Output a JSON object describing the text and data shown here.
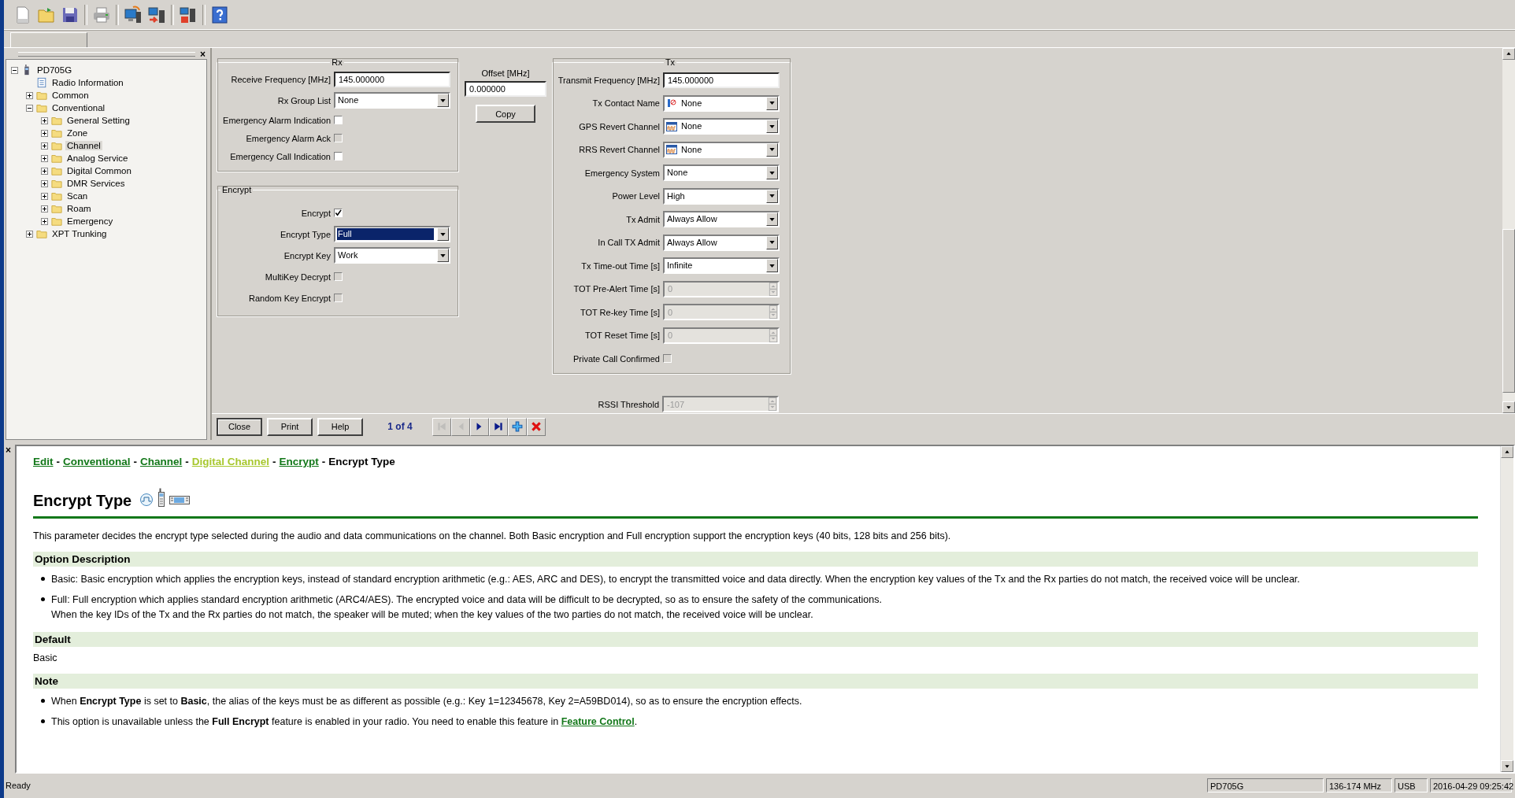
{
  "sidebar": {
    "close": "×",
    "tree": [
      {
        "label": "PD705G",
        "kind": "device",
        "expanded": true,
        "selected": false,
        "children": [
          {
            "label": "Radio Information",
            "kind": "document",
            "selected": false
          },
          {
            "label": "Common",
            "kind": "folder",
            "expanded": false,
            "selected": false
          },
          {
            "label": "Conventional",
            "kind": "folder",
            "expanded": true,
            "selected": false,
            "children": [
              {
                "label": "General Setting",
                "kind": "folder",
                "expanded": false,
                "selected": false
              },
              {
                "label": "Zone",
                "kind": "folder",
                "expanded": false,
                "selected": false
              },
              {
                "label": "Channel",
                "kind": "folder",
                "expanded": false,
                "selected": true
              },
              {
                "label": "Analog Service",
                "kind": "folder",
                "expanded": false,
                "selected": false
              },
              {
                "label": "Digital Common",
                "kind": "folder",
                "expanded": false,
                "selected": false
              },
              {
                "label": "DMR Services",
                "kind": "folder",
                "expanded": false,
                "selected": false
              },
              {
                "label": "Scan",
                "kind": "folder",
                "expanded": false,
                "selected": false
              },
              {
                "label": "Roam",
                "kind": "folder",
                "expanded": false,
                "selected": false
              },
              {
                "label": "Emergency",
                "kind": "folder",
                "expanded": false,
                "selected": false
              }
            ]
          },
          {
            "label": "XPT Trunking",
            "kind": "folder",
            "expanded": false,
            "selected": false
          }
        ]
      }
    ]
  },
  "rx": {
    "title": "Rx",
    "fields": [
      {
        "label": "Receive Frequency [MHz]",
        "kind": "text",
        "value": "145.000000"
      },
      {
        "label": "Rx Group List",
        "kind": "dropdown",
        "value": "None",
        "focused": false
      },
      {
        "label": "Emergency Alarm Indication",
        "kind": "checkbox",
        "checked": false,
        "disabled": false
      },
      {
        "label": "Emergency Alarm Ack",
        "kind": "checkbox",
        "checked": false,
        "disabled": true
      },
      {
        "label": "Emergency Call Indication",
        "kind": "checkbox",
        "checked": false,
        "disabled": false
      }
    ]
  },
  "encrypt": {
    "title": "Encrypt",
    "fields": [
      {
        "label": "Encrypt",
        "kind": "checkbox",
        "checked": true,
        "disabled": false
      },
      {
        "label": "Encrypt Type",
        "kind": "dropdown",
        "value": "Full",
        "focused": true
      },
      {
        "label": "Encrypt Key",
        "kind": "dropdown",
        "value": "Work",
        "focused": false
      },
      {
        "label": "MultiKey Decrypt",
        "kind": "checkbox",
        "checked": false,
        "disabled": true
      },
      {
        "label": "Random Key Encrypt",
        "kind": "checkbox",
        "checked": false,
        "disabled": true
      }
    ]
  },
  "offset": {
    "label": "Offset [MHz]",
    "value": "0.000000",
    "button": "Copy"
  },
  "tx": {
    "title": "Tx",
    "fields": [
      {
        "label": "Transmit Frequency [MHz]",
        "kind": "text",
        "value": "145.000000"
      },
      {
        "label": "Tx Contact Name",
        "kind": "contact",
        "value": "None",
        "focused": false
      },
      {
        "label": "GPS Revert Channel",
        "kind": "channel",
        "value": "None",
        "focused": false
      },
      {
        "label": "RRS Revert Channel",
        "kind": "channel",
        "value": "None",
        "focused": false
      },
      {
        "label": "Emergency System",
        "kind": "dropdown",
        "value": "None",
        "focused": false
      },
      {
        "label": "Power Level",
        "kind": "dropdown",
        "value": "High",
        "focused": false
      },
      {
        "label": "Tx Admit",
        "kind": "dropdown",
        "value": "Always Allow",
        "focused": false
      },
      {
        "label": "In Call TX Admit",
        "kind": "dropdown",
        "value": "Always Allow",
        "focused": false
      },
      {
        "label": "Tx Time-out Time [s]",
        "kind": "dropdown",
        "value": "Infinite",
        "focused": false
      },
      {
        "label": "TOT Pre-Alert Time [s]",
        "kind": "spinner",
        "value": "0",
        "disabled": true
      },
      {
        "label": "TOT Re-key Time [s]",
        "kind": "spinner",
        "value": "0",
        "disabled": true
      },
      {
        "label": "TOT Reset Time [s]",
        "kind": "spinner",
        "value": "0",
        "disabled": true
      },
      {
        "label": "Private Call Confirmed",
        "kind": "checkbox",
        "checked": false,
        "disabled": true
      }
    ]
  },
  "rssi": {
    "label": "RSSI Threshold",
    "value": "-107",
    "disabled": true
  },
  "nav": {
    "buttons": [
      {
        "label": "Close",
        "default": true
      },
      {
        "label": "Print",
        "default": false
      },
      {
        "label": "Help",
        "default": false
      }
    ],
    "record": "1 of 4",
    "controls": [
      {
        "kind": "first",
        "disabled": true
      },
      {
        "kind": "previous",
        "disabled": true
      },
      {
        "kind": "next",
        "disabled": false
      },
      {
        "kind": "last",
        "disabled": false
      },
      {
        "kind": "add",
        "disabled": false
      },
      {
        "kind": "delete",
        "disabled": false
      }
    ]
  },
  "help": {
    "close": "×",
    "breadcrumb": [
      {
        "kind": "link",
        "text": "Edit"
      },
      {
        "kind": "separator",
        "text": "-"
      },
      {
        "kind": "link",
        "text": "Conventional"
      },
      {
        "kind": "separator",
        "text": "-"
      },
      {
        "kind": "link",
        "text": "Channel"
      },
      {
        "kind": "separator",
        "text": "-"
      },
      {
        "kind": "visited",
        "text": "Digital Channel"
      },
      {
        "kind": "separator",
        "text": "-"
      },
      {
        "kind": "link",
        "text": "Encrypt"
      },
      {
        "kind": "separator",
        "text": "-"
      },
      {
        "kind": "current",
        "text": "Encrypt Type"
      }
    ],
    "title": "Encrypt Type",
    "intro": "This parameter decides the encrypt type selected during the audio and data communications on the channel. Both Basic encryption and Full encryption support the encryption keys (40 bits, 128 bits and 256 bits).",
    "sections": [
      {
        "heading": "Option Description",
        "bullets": [
          {
            "lines": [
              "Basic: Basic encryption which applies the encryption keys, instead of standard encryption arithmetic (e.g.: AES, ARC and DES), to encrypt the transmitted voice and data directly. When the encryption key values of the Tx and the Rx parties do not match, the received voice will be unclear."
            ]
          },
          {
            "lines": [
              "Full: Full encryption which applies standard encryption arithmetic (ARC4/AES). The encrypted voice and data will be difficult to be decrypted, so as to ensure the safety of the communications.",
              "When the key IDs of the Tx and the Rx parties do not match, the speaker will be muted; when the key values of the two parties do not match, the received voice will be unclear."
            ]
          }
        ]
      },
      {
        "heading": "Default",
        "paragraph": "Basic"
      },
      {
        "heading": "Note",
        "bullets": [
          {
            "lines": [
              "When **Encrypt Type** is set to **Basic**, the alias of the keys must be as different as possible (e.g.: Key 1=12345678, Key 2=A59BD014), so as to ensure the encryption effects."
            ]
          },
          {
            "lines": [
              "This option is unavailable unless the **Full Encrypt** feature is enabled in your radio. You need to enable this feature in "
            ],
            "link": "Feature Control",
            "after": "."
          }
        ]
      }
    ]
  },
  "status_bar": {
    "message": "Ready",
    "panels": [
      "PD705G",
      "136-174 MHz",
      "USB",
      "2016-04-29 09:25:42"
    ]
  }
}
